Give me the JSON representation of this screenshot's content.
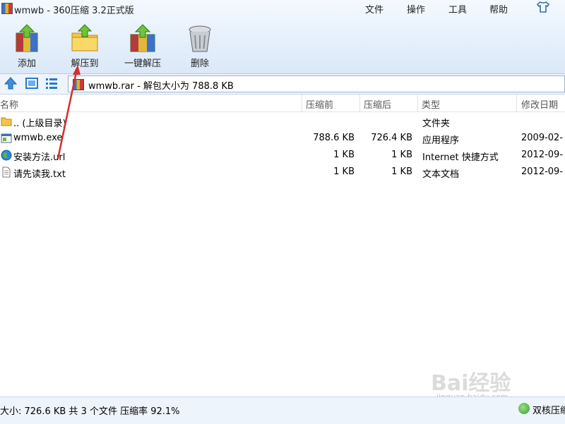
{
  "window": {
    "title": "wmwb - 360压缩 3.2正式版"
  },
  "menu": [
    "文件",
    "操作",
    "工具",
    "帮助"
  ],
  "skin_icon": "tshirt-icon",
  "toolbar": [
    {
      "label": "添加",
      "icon": "add-archive-icon"
    },
    {
      "label": "解压到",
      "icon": "extract-to-folder-icon"
    },
    {
      "label": "一键解压",
      "icon": "one-click-extract-icon"
    },
    {
      "label": "删除",
      "icon": "trash-icon"
    }
  ],
  "nav": {
    "up_icon": "up-arrow-icon",
    "view1_icon": "large-icon-view-icon",
    "view2_icon": "detail-view-icon"
  },
  "address": {
    "text": "wmwb.rar - 解包大小为 788.8 KB"
  },
  "columns": [
    "名称",
    "压缩前",
    "压缩后",
    "类型",
    "修改日期"
  ],
  "files": [
    {
      "name": ".. (上级目录)",
      "size_before": "",
      "size_after": "",
      "type": "文件夹",
      "date": "",
      "icon": "folder-icon"
    },
    {
      "name": "wmwb.exe",
      "size_before": "788.6 KB",
      "size_after": "726.4 KB",
      "type": "应用程序",
      "date": "2009-02-",
      "icon": "exe-icon"
    },
    {
      "name": "安装方法.url",
      "size_before": "1 KB",
      "size_after": "1 KB",
      "type": "Internet 快捷方式",
      "date": "2012-09-",
      "icon": "globe-icon"
    },
    {
      "name": "请先读我.txt",
      "size_before": "1 KB",
      "size_after": "1 KB",
      "type": "文本文档",
      "date": "2012-09-",
      "icon": "text-file-icon"
    }
  ],
  "status": {
    "text": "大小: 726.6 KB 共 3 个文件 压缩率 92.1%",
    "core": "双核压缩"
  },
  "watermark": {
    "main": "Bai经验",
    "sub": "jingyan.baidu.com"
  },
  "colors": {
    "annotation_arrow": "#d32f2f",
    "toolbar_bg": "#e4effb"
  }
}
